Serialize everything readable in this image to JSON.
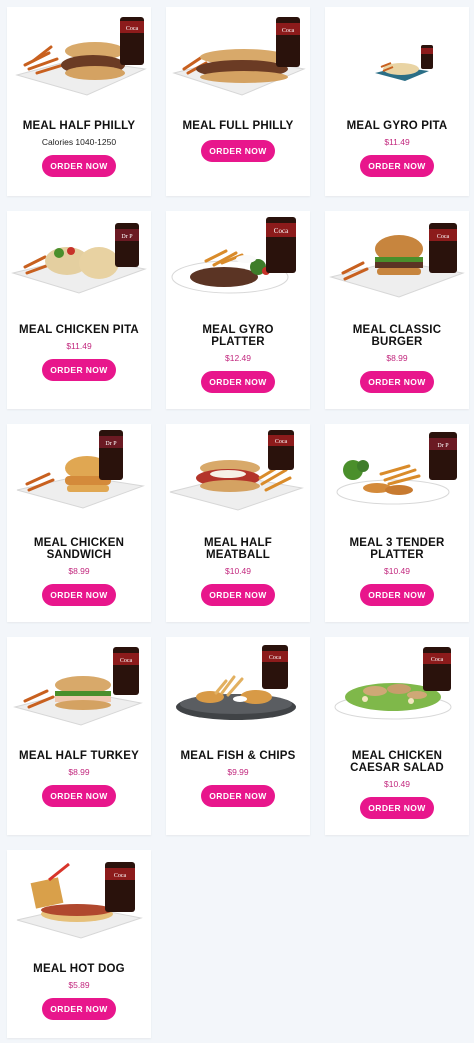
{
  "cta_label": "ORDER NOW",
  "accent_color": "#e8168c",
  "price_color": "#c2287e",
  "items": [
    {
      "name": "MEAL HALF PHILLY",
      "subtitle": "Calories 1040-1250",
      "price": "",
      "image": "half-philly-meal-image",
      "drink": "coca-cola"
    },
    {
      "name": "MEAL FULL PHILLY",
      "subtitle": "",
      "price": "",
      "image": "full-philly-meal-image",
      "drink": "coca-cola"
    },
    {
      "name": "MEAL GYRO PITA",
      "subtitle": "",
      "price": "$11.49",
      "image": "gyro-pita-meal-image",
      "drink": "coca-cola"
    },
    {
      "name": "MEAL CHICKEN PITA",
      "subtitle": "",
      "price": "$11.49",
      "image": "chicken-pita-meal-image",
      "drink": "dr-pepper"
    },
    {
      "name": "MEAL GYRO PLATTER",
      "subtitle": "",
      "price": "$12.49",
      "image": "gyro-platter-meal-image",
      "drink": "coca-cola"
    },
    {
      "name": "MEAL CLASSIC BURGER",
      "subtitle": "",
      "price": "$8.99",
      "image": "classic-burger-meal-image",
      "drink": "coca-cola"
    },
    {
      "name": "MEAL CHICKEN SANDWICH",
      "subtitle": "",
      "price": "$8.99",
      "image": "chicken-sandwich-meal-image",
      "drink": "dr-pepper"
    },
    {
      "name": "MEAL HALF MEATBALL",
      "subtitle": "",
      "price": "$10.49",
      "image": "half-meatball-meal-image",
      "drink": "coca-cola"
    },
    {
      "name": "MEAL 3 TENDER PLATTER",
      "subtitle": "",
      "price": "$10.49",
      "image": "tender-platter-meal-image",
      "drink": "dr-pepper"
    },
    {
      "name": "MEAL HALF TURKEY",
      "subtitle": "",
      "price": "$8.99",
      "image": "half-turkey-meal-image",
      "drink": "coca-cola"
    },
    {
      "name": "MEAL FISH & CHIPS",
      "subtitle": "",
      "price": "$9.99",
      "image": "fish-chips-meal-image",
      "drink": "coca-cola"
    },
    {
      "name": "MEAL CHICKEN CAESAR SALAD",
      "subtitle": "",
      "price": "$10.49",
      "image": "chicken-caesar-salad-meal-image",
      "drink": "coca-cola"
    },
    {
      "name": "MEAL HOT DOG",
      "subtitle": "",
      "price": "$5.89",
      "image": "hot-dog-meal-image",
      "drink": "coca-cola"
    }
  ]
}
